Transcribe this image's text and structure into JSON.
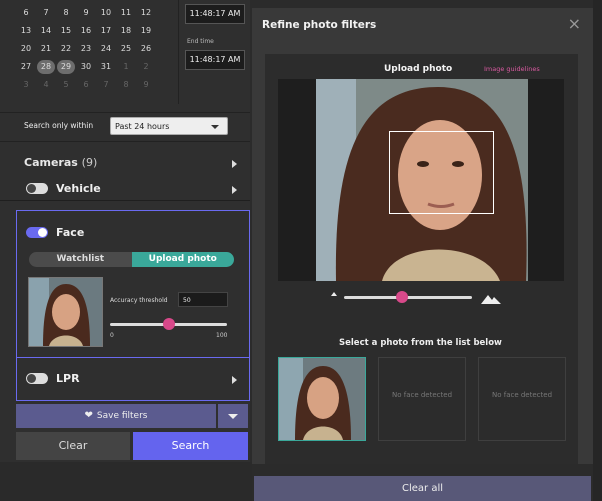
{
  "calendar": {
    "rows": [
      [
        {
          "d": "6"
        },
        {
          "d": "7"
        },
        {
          "d": "8"
        },
        {
          "d": "9"
        },
        {
          "d": "10"
        },
        {
          "d": "11"
        },
        {
          "d": "12"
        }
      ],
      [
        {
          "d": "13"
        },
        {
          "d": "14"
        },
        {
          "d": "15"
        },
        {
          "d": "16"
        },
        {
          "d": "17"
        },
        {
          "d": "18"
        },
        {
          "d": "19"
        }
      ],
      [
        {
          "d": "20"
        },
        {
          "d": "21"
        },
        {
          "d": "22"
        },
        {
          "d": "23"
        },
        {
          "d": "24"
        },
        {
          "d": "25"
        },
        {
          "d": "26"
        }
      ],
      [
        {
          "d": "27"
        },
        {
          "d": "28",
          "sel": true
        },
        {
          "d": "29",
          "sel": true
        },
        {
          "d": "30"
        },
        {
          "d": "31"
        },
        {
          "d": "1",
          "dim": true
        },
        {
          "d": "2",
          "dim": true
        }
      ],
      [
        {
          "d": "3",
          "dim": true
        },
        {
          "d": "4",
          "dim": true
        },
        {
          "d": "5",
          "dim": true
        },
        {
          "d": "6",
          "dim": true
        },
        {
          "d": "7",
          "dim": true
        },
        {
          "d": "8",
          "dim": true
        },
        {
          "d": "9",
          "dim": true
        }
      ]
    ],
    "start_time": "11:48:17 AM",
    "end_label": "End time",
    "end_time": "11:48:17 AM"
  },
  "search_within": {
    "label": "Search only within",
    "value": "Past 24 hours"
  },
  "cameras": {
    "label": "Cameras",
    "count": "(9)"
  },
  "vehicle": {
    "label": "Vehicle",
    "enabled": false
  },
  "face": {
    "label": "Face",
    "enabled": true,
    "tabs": [
      "Watchlist",
      "Upload photo"
    ],
    "active_tab": "Upload photo",
    "accuracy_label": "Accuracy threshold",
    "accuracy_value": "50",
    "slider_min": "0",
    "slider_max": "100"
  },
  "lpr": {
    "label": "LPR",
    "enabled": false
  },
  "actions": {
    "save": "Save filters",
    "clear": "Clear",
    "search": "Search"
  },
  "dialog": {
    "title": "Refine photo filters",
    "close": "×",
    "upload_title": "Upload photo",
    "guidelines": "Image guidelines",
    "select_label": "Select a photo from the list below",
    "candidates": [
      {
        "type": "photo",
        "text": ""
      },
      {
        "type": "none",
        "text": "No face detected"
      },
      {
        "type": "none",
        "text": "No face detected"
      }
    ],
    "zoom_level": 0.45
  },
  "clear_all": "Clear all",
  "colors": {
    "accent": "#6464ee",
    "teal": "#3aa89a",
    "pink": "#d8498a"
  }
}
